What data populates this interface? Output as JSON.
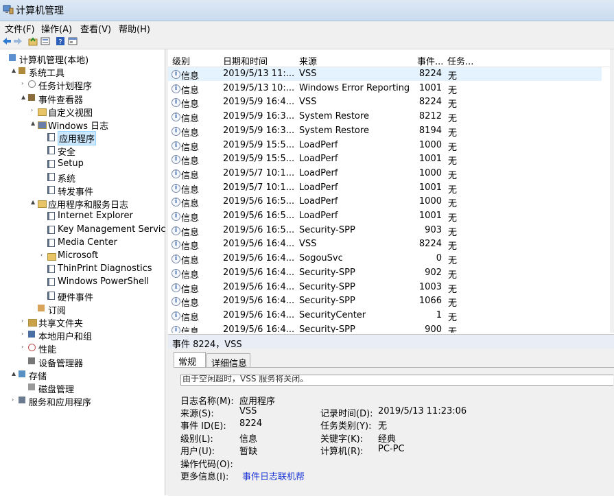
{
  "window": {
    "title": "计算机管理"
  },
  "menu": [
    "文件(F)",
    "操作(A)",
    "查看(V)",
    "帮助(H)"
  ],
  "toolbar": {
    "buttons": [
      "back-icon",
      "forward-icon",
      "up-icon",
      "properties-icon",
      "help-icon",
      "show-pane-icon"
    ]
  },
  "tree": [
    {
      "label": "计算机管理(本地)",
      "icon": "computer-management-icon",
      "expander": ""
    },
    {
      "label": "系统工具",
      "icon": "tools-icon",
      "expander": "▲"
    },
    {
      "label": "任务计划程序",
      "icon": "clock-icon",
      "expander": "›"
    },
    {
      "label": "事件查看器",
      "icon": "event-viewer-icon",
      "expander": "▲"
    },
    {
      "label": "自定义视图",
      "icon": "folder-icon",
      "expander": "›"
    },
    {
      "label": "Windows 日志",
      "icon": "log-folder-icon",
      "expander": "▲"
    },
    {
      "label": "应用程序",
      "icon": "log-icon",
      "expander": ""
    },
    {
      "label": "安全",
      "icon": "log-icon",
      "expander": ""
    },
    {
      "label": "Setup",
      "icon": "log-icon",
      "expander": ""
    },
    {
      "label": "系统",
      "icon": "log-icon",
      "expander": ""
    },
    {
      "label": "转发事件",
      "icon": "log-icon",
      "expander": ""
    },
    {
      "label": "应用程序和服务日志",
      "icon": "folder-icon",
      "expander": "▲"
    },
    {
      "label": "Internet Explorer",
      "icon": "log-icon",
      "expander": ""
    },
    {
      "label": "Key Management Service",
      "icon": "log-icon",
      "expander": ""
    },
    {
      "label": "Media Center",
      "icon": "log-icon",
      "expander": ""
    },
    {
      "label": "Microsoft",
      "icon": "folder-icon",
      "expander": "›"
    },
    {
      "label": "ThinPrint Diagnostics",
      "icon": "log-icon",
      "expander": ""
    },
    {
      "label": "Windows PowerShell",
      "icon": "log-icon",
      "expander": ""
    },
    {
      "label": "硬件事件",
      "icon": "log-icon",
      "expander": ""
    },
    {
      "label": "订阅",
      "icon": "subscription-icon",
      "expander": ""
    },
    {
      "label": "共享文件夹",
      "icon": "shared-folder-icon",
      "expander": "›"
    },
    {
      "label": "本地用户和组",
      "icon": "users-icon",
      "expander": "›"
    },
    {
      "label": "性能",
      "icon": "performance-icon",
      "expander": "›"
    },
    {
      "label": "设备管理器",
      "icon": "device-manager-icon",
      "expander": ""
    },
    {
      "label": "存储",
      "icon": "storage-icon",
      "expander": "▲"
    },
    {
      "label": "磁盘管理",
      "icon": "disk-icon",
      "expander": ""
    },
    {
      "label": "服务和应用程序",
      "icon": "services-icon",
      "expander": "›"
    }
  ],
  "table": {
    "headers": [
      "级别",
      "日期和时间",
      "来源",
      "事件...",
      "任务..."
    ],
    "rows": [
      [
        "信息",
        "2019/5/13 11:...",
        "VSS",
        "8224",
        "无"
      ],
      [
        "信息",
        "2019/5/13 10:...",
        "Windows Error Reporting",
        "1001",
        "无"
      ],
      [
        "信息",
        "2019/5/9 16:4...",
        "VSS",
        "8224",
        "无"
      ],
      [
        "信息",
        "2019/5/9 16:3...",
        "System Restore",
        "8212",
        "无"
      ],
      [
        "信息",
        "2019/5/9 16:3...",
        "System Restore",
        "8194",
        "无"
      ],
      [
        "信息",
        "2019/5/9 15:5...",
        "LoadPerf",
        "1000",
        "无"
      ],
      [
        "信息",
        "2019/5/9 15:5...",
        "LoadPerf",
        "1001",
        "无"
      ],
      [
        "信息",
        "2019/5/7 10:1...",
        "LoadPerf",
        "1000",
        "无"
      ],
      [
        "信息",
        "2019/5/7 10:1...",
        "LoadPerf",
        "1001",
        "无"
      ],
      [
        "信息",
        "2019/5/6 16:5...",
        "LoadPerf",
        "1000",
        "无"
      ],
      [
        "信息",
        "2019/5/6 16:5...",
        "LoadPerf",
        "1001",
        "无"
      ],
      [
        "信息",
        "2019/5/6 16:5...",
        "Security-SPP",
        "903",
        "无"
      ],
      [
        "信息",
        "2019/5/6 16:4...",
        "VSS",
        "8224",
        "无"
      ],
      [
        "信息",
        "2019/5/6 16:4...",
        "SogouSvc",
        "0",
        "无"
      ],
      [
        "信息",
        "2019/5/6 16:4...",
        "Security-SPP",
        "902",
        "无"
      ],
      [
        "信息",
        "2019/5/6 16:4...",
        "Security-SPP",
        "1003",
        "无"
      ],
      [
        "信息",
        "2019/5/6 16:4...",
        "Security-SPP",
        "1066",
        "无"
      ],
      [
        "信息",
        "2019/5/6 16:4...",
        "SecurityCenter",
        "1",
        "无"
      ],
      [
        "信息",
        "2019/5/6 16:4...",
        "Security-SPP",
        "900",
        "无"
      ]
    ]
  },
  "detail": {
    "header": "事件 8224，VSS",
    "tabs": [
      "常规",
      "详细信息"
    ],
    "description": "由于空闲超时，VSS 服务将关闭。",
    "log_name_label": "日志名称(M):",
    "log_name": "应用程序",
    "source_label": "来源(S):",
    "source": "VSS",
    "logged_label": "记录时间(D):",
    "logged": "2019/5/13 11:23:06",
    "event_id_label": "事件 ID(E):",
    "event_id": "8224",
    "task_label": "任务类别(Y):",
    "task": "无",
    "level_label": "级别(L):",
    "level": "信息",
    "keywords_label": "关键字(K):",
    "keywords": "经典",
    "user_label": "用户(U):",
    "user": "暂缺",
    "computer_label": "计算机(R):",
    "computer": "PC-PC",
    "opcode_label": "操作代码(O):",
    "more_info_label": "更多信息(I):",
    "more_info_link": "事件日志联机帮"
  }
}
